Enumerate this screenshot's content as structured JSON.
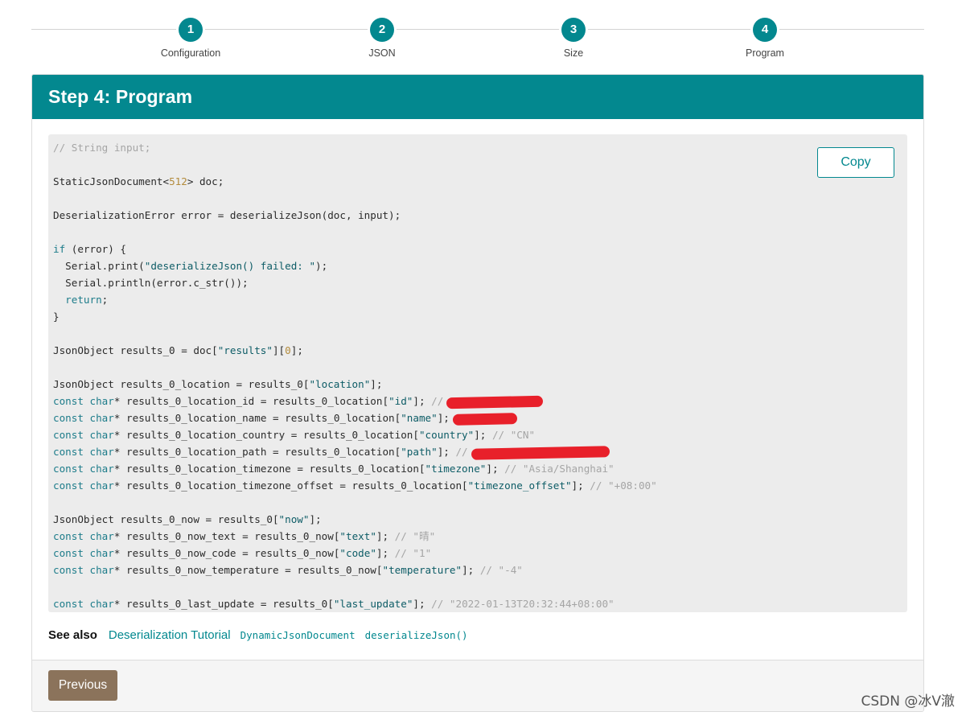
{
  "stepper": {
    "steps": [
      {
        "number": "1",
        "label": "Configuration"
      },
      {
        "number": "2",
        "label": "JSON"
      },
      {
        "number": "3",
        "label": "Size"
      },
      {
        "number": "4",
        "label": "Program"
      }
    ]
  },
  "card": {
    "title": "Step 4: Program",
    "copy_label": "Copy"
  },
  "code": {
    "lines": [
      "// String input;",
      "",
      "StaticJsonDocument<512> doc;",
      "",
      "DeserializationError error = deserializeJson(doc, input);",
      "",
      "if (error) {",
      "  Serial.print(\"deserializeJson() failed: \");",
      "  Serial.println(error.c_str());",
      "  return;",
      "}",
      "",
      "JsonObject results_0 = doc[\"results\"][0];",
      "",
      "JsonObject results_0_location = results_0[\"location\"];",
      "const char* results_0_location_id = results_0_location[\"id\"]; //",
      "const char* results_0_location_name = results_0_location[\"name\"];",
      "const char* results_0_location_country = results_0_location[\"country\"]; // \"CN\"",
      "const char* results_0_location_path = results_0_location[\"path\"]; //",
      "const char* results_0_location_timezone = results_0_location[\"timezone\"]; // \"Asia/Shanghai\"",
      "const char* results_0_location_timezone_offset = results_0_location[\"timezone_offset\"]; // \"+08:00\"",
      "",
      "JsonObject results_0_now = results_0[\"now\"];",
      "const char* results_0_now_text = results_0_now[\"text\"]; // \"晴\"",
      "const char* results_0_now_code = results_0_now[\"code\"]; // \"1\"",
      "const char* results_0_now_temperature = results_0_now[\"temperature\"]; // \"-4\"",
      "",
      "const char* results_0_last_update = results_0[\"last_update\"]; // \"2022-01-13T20:32:44+08:00\""
    ],
    "redacted_lines": [
      15,
      16,
      18
    ]
  },
  "see_also": {
    "label": "See also",
    "links": [
      {
        "text": "Deserialization Tutorial",
        "mono": false
      },
      {
        "text": "DynamicJsonDocument",
        "mono": true
      },
      {
        "text": "deserializeJson()",
        "mono": true
      }
    ]
  },
  "footer": {
    "previous_label": "Previous"
  },
  "watermark": "CSDN @冰V澈",
  "colors": {
    "accent": "#03888f",
    "previous_button": "#8b735b",
    "redaction": "#e8202a"
  }
}
